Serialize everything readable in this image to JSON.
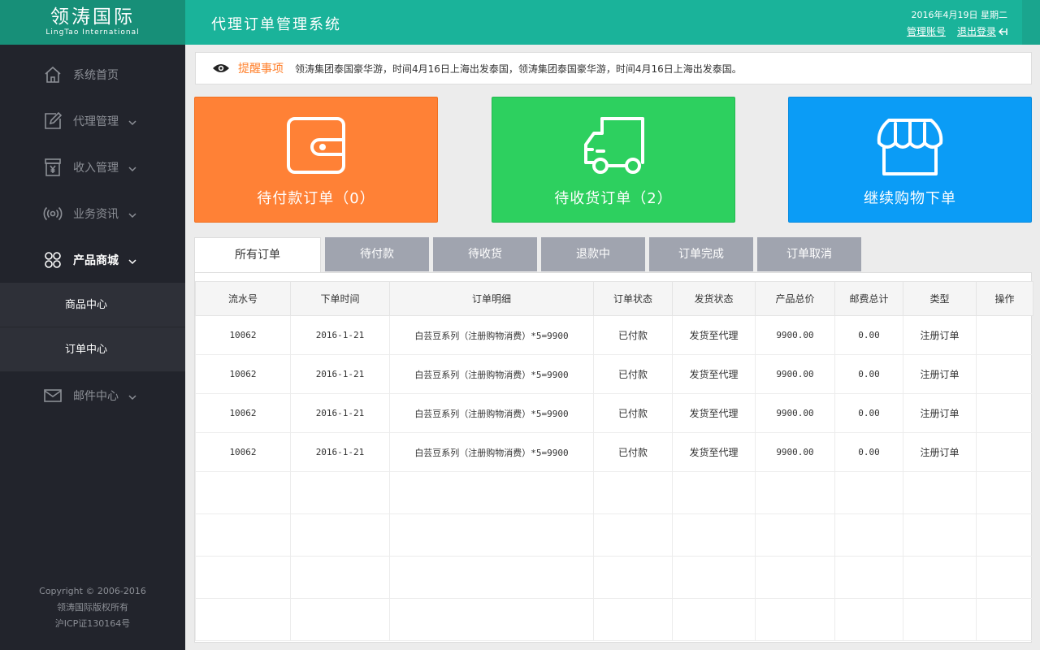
{
  "brand": {
    "name_cn": "领涛国际",
    "name_en": "LingTao International"
  },
  "header": {
    "title": "代理订单管理系统",
    "date": "2016年4月19日 星期二",
    "account_link": "管理账号",
    "logout_link": "退出登录"
  },
  "sidebar": {
    "items": [
      {
        "label": "系统首页",
        "icon": "home-icon"
      },
      {
        "label": "代理管理",
        "icon": "edit-icon"
      },
      {
        "label": "收入管理",
        "icon": "income-icon"
      },
      {
        "label": "业务资讯",
        "icon": "broadcast-icon"
      },
      {
        "label": "产品商城",
        "icon": "clover-icon"
      },
      {
        "label": "邮件中心",
        "icon": "mail-icon"
      }
    ],
    "sub_items": [
      {
        "label": "商品中心"
      },
      {
        "label": "订单中心"
      }
    ],
    "footer": {
      "copyright": "Copyright © 2006-2016",
      "rights": "领涛国际版权所有",
      "icp": "沪ICP证130164号"
    }
  },
  "notice": {
    "title": "提醒事项",
    "text": "领涛集团泰国豪华游，时间4月16日上海出发泰国，领涛集团泰国豪华游，时间4月16日上海出发泰国。"
  },
  "cards": [
    {
      "label": "待付款订单（0）",
      "color": "#ff8136",
      "icon": "wallet-icon"
    },
    {
      "label": "待收货订单（2）",
      "color": "#2dd05f",
      "icon": "truck-icon"
    },
    {
      "label": "继续购物下单",
      "color": "#0b9cf6",
      "icon": "shop-icon"
    }
  ],
  "tabs": [
    {
      "label": "所有订单"
    },
    {
      "label": "待付款"
    },
    {
      "label": "待收货"
    },
    {
      "label": "退款中"
    },
    {
      "label": "订单完成"
    },
    {
      "label": "订单取消"
    }
  ],
  "table": {
    "columns": [
      "流水号",
      "下单时间",
      "订单明细",
      "订单状态",
      "发货状态",
      "产品总价",
      "邮费总计",
      "类型",
      "操作"
    ],
    "rows": [
      [
        "10062",
        "2016-1-21",
        "白芸豆系列（注册购物消费）*5=9900",
        "已付款",
        "发货至代理",
        "9900.00",
        "0.00",
        "注册订单",
        ""
      ],
      [
        "10062",
        "2016-1-21",
        "白芸豆系列（注册购物消费）*5=9900",
        "已付款",
        "发货至代理",
        "9900.00",
        "0.00",
        "注册订单",
        ""
      ],
      [
        "10062",
        "2016-1-21",
        "白芸豆系列（注册购物消费）*5=9900",
        "已付款",
        "发货至代理",
        "9900.00",
        "0.00",
        "注册订单",
        ""
      ],
      [
        "10062",
        "2016-1-21",
        "白芸豆系列（注册购物消费）*5=9900",
        "已付款",
        "发货至代理",
        "9900.00",
        "0.00",
        "注册订单",
        ""
      ]
    ],
    "empty_rows": 4
  }
}
